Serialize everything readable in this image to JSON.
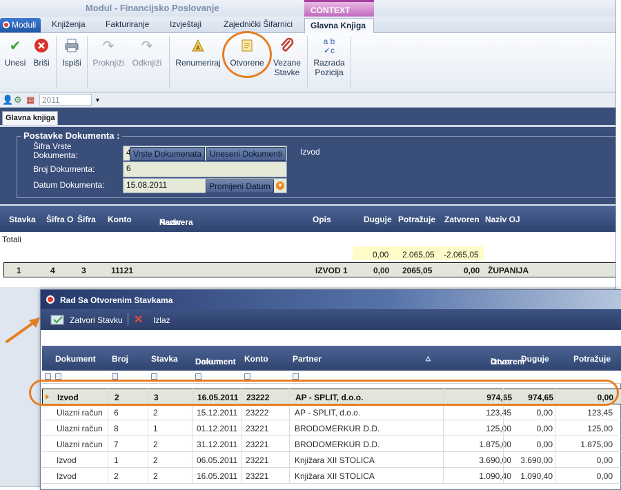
{
  "window": {
    "title": "Modul - Financijsko Poslovanje",
    "context_label": "CONTEXT"
  },
  "tabs": [
    {
      "label": "Moduli"
    },
    {
      "label": "Knjiženja"
    },
    {
      "label": "Fakturiranje"
    },
    {
      "label": "Izvještaji"
    },
    {
      "label": "Zajednički Šifarnici"
    },
    {
      "label": "Glavna Knjiga"
    }
  ],
  "ribbon": {
    "unesi": "Unesi",
    "brisi": "Briši",
    "ispisi": "Ispiši",
    "proknjizi": "Proknjiži",
    "odknjizi": "Odknjiži",
    "renumeriraj": "Renumeriraj",
    "otvorene": "Otvorene",
    "vezane_1": "Vezane",
    "vezane_2": "Stavke",
    "razrada_1": "Razrada",
    "razrada_2": "Pozicija"
  },
  "toolbar": {
    "year": "2011"
  },
  "doc_tab": "Glavna knjiga",
  "form": {
    "legend": "Postavke Dokumenta :",
    "sifra_label_1": "Šifra Vrste",
    "sifra_label_2": "Dokumenta:",
    "sifra_value": "4",
    "vrste_button": "Vrste Dokumenata",
    "uneseni_button": "Uneseni Dokumenti",
    "sifra_desc": "Izvod",
    "broj_label": "Broj Dokumenta:",
    "broj_value": "6",
    "datum_label": "Datum Dokumenta:",
    "datum_value": "15.08.2011",
    "promijeni_button": "Promijeni Datum"
  },
  "grid1": {
    "headers": {
      "stavka": "Stavka",
      "sifra_o": "Šifra O",
      "sifra": "Šifra",
      "konto": "Konto",
      "naziv_1": "Naziv",
      "naziv_2": "Partnera",
      "opis": "Opis",
      "duguje": "Duguje",
      "potrazuje": "Potražuje",
      "zatvoren": "Zatvoren",
      "naziv_oj": "Naziv OJ"
    },
    "totals_label": "Totali",
    "totals": {
      "duguje": "0,00",
      "potrazuje": "2.065,05",
      "zatvoren": "-2.065,05"
    },
    "row": {
      "stavka": "1",
      "sifra_o": "4",
      "sifra": "3",
      "konto": "11121",
      "opis": "IZVOD 1",
      "duguje": "0,00",
      "potrazuje": "2065,05",
      "zatvoren": "0,00",
      "naziv_oj": "ŽUPANIJA"
    }
  },
  "child": {
    "title": "Rad Sa Otvorenim Stavkama",
    "zatvori": "Zatvori Stavku",
    "izlaz": "Izlaz",
    "headers": {
      "dokument": "Dokument",
      "broj": "Broj",
      "stavka": "Stavka",
      "datum_1": "Datum",
      "datum_2": "Dokument",
      "konto": "Konto",
      "partner": "Partner",
      "otvoreni_1": "Otvoreni",
      "otvoreni_2": "iznos",
      "duguje": "Duguje",
      "potrazuje": "Potražuje"
    },
    "rows": [
      {
        "dokument": "Izvod",
        "broj": "2",
        "stavka": "3",
        "datum": "16.05.2011",
        "konto": "23222",
        "partner": "AP - SPLIT, d.o.o.",
        "otvoreni": "974,65",
        "duguje": "974,65",
        "potrazuje": "0,00"
      },
      {
        "dokument": "Ulazni račun",
        "broj": "6",
        "stavka": "2",
        "datum": "15.12.2011",
        "konto": "23222",
        "partner": "AP - SPLIT, d.o.o.",
        "otvoreni": "123,45",
        "duguje": "0,00",
        "potrazuje": "123,45"
      },
      {
        "dokument": "Ulazni račun",
        "broj": "8",
        "stavka": "1",
        "datum": "01.12.2011",
        "konto": "23221",
        "partner": "BRODOMERKUR D.D.",
        "otvoreni": "125,00",
        "duguje": "0,00",
        "potrazuje": "125,00"
      },
      {
        "dokument": "Ulazni račun",
        "broj": "7",
        "stavka": "2",
        "datum": "31.12.2011",
        "konto": "23221",
        "partner": "BRODOMERKUR D.D.",
        "otvoreni": "1.875,00",
        "duguje": "0,00",
        "potrazuje": "1.875,00"
      },
      {
        "dokument": "Izvod",
        "broj": "1",
        "stavka": "2",
        "datum": "06.05.2011",
        "konto": "23221",
        "partner": "Knjižara XII STOLICA",
        "otvoreni": "3.690,00",
        "duguje": "3.690,00",
        "potrazuje": "0,00"
      },
      {
        "dokument": "Izvod",
        "broj": "2",
        "stavka": "2",
        "datum": "16.05.2011",
        "konto": "23221",
        "partner": "Knjižara XII STOLICA",
        "otvoreni": "1.090,40",
        "duguje": "1.090,40",
        "potrazuje": "0,00"
      }
    ]
  }
}
